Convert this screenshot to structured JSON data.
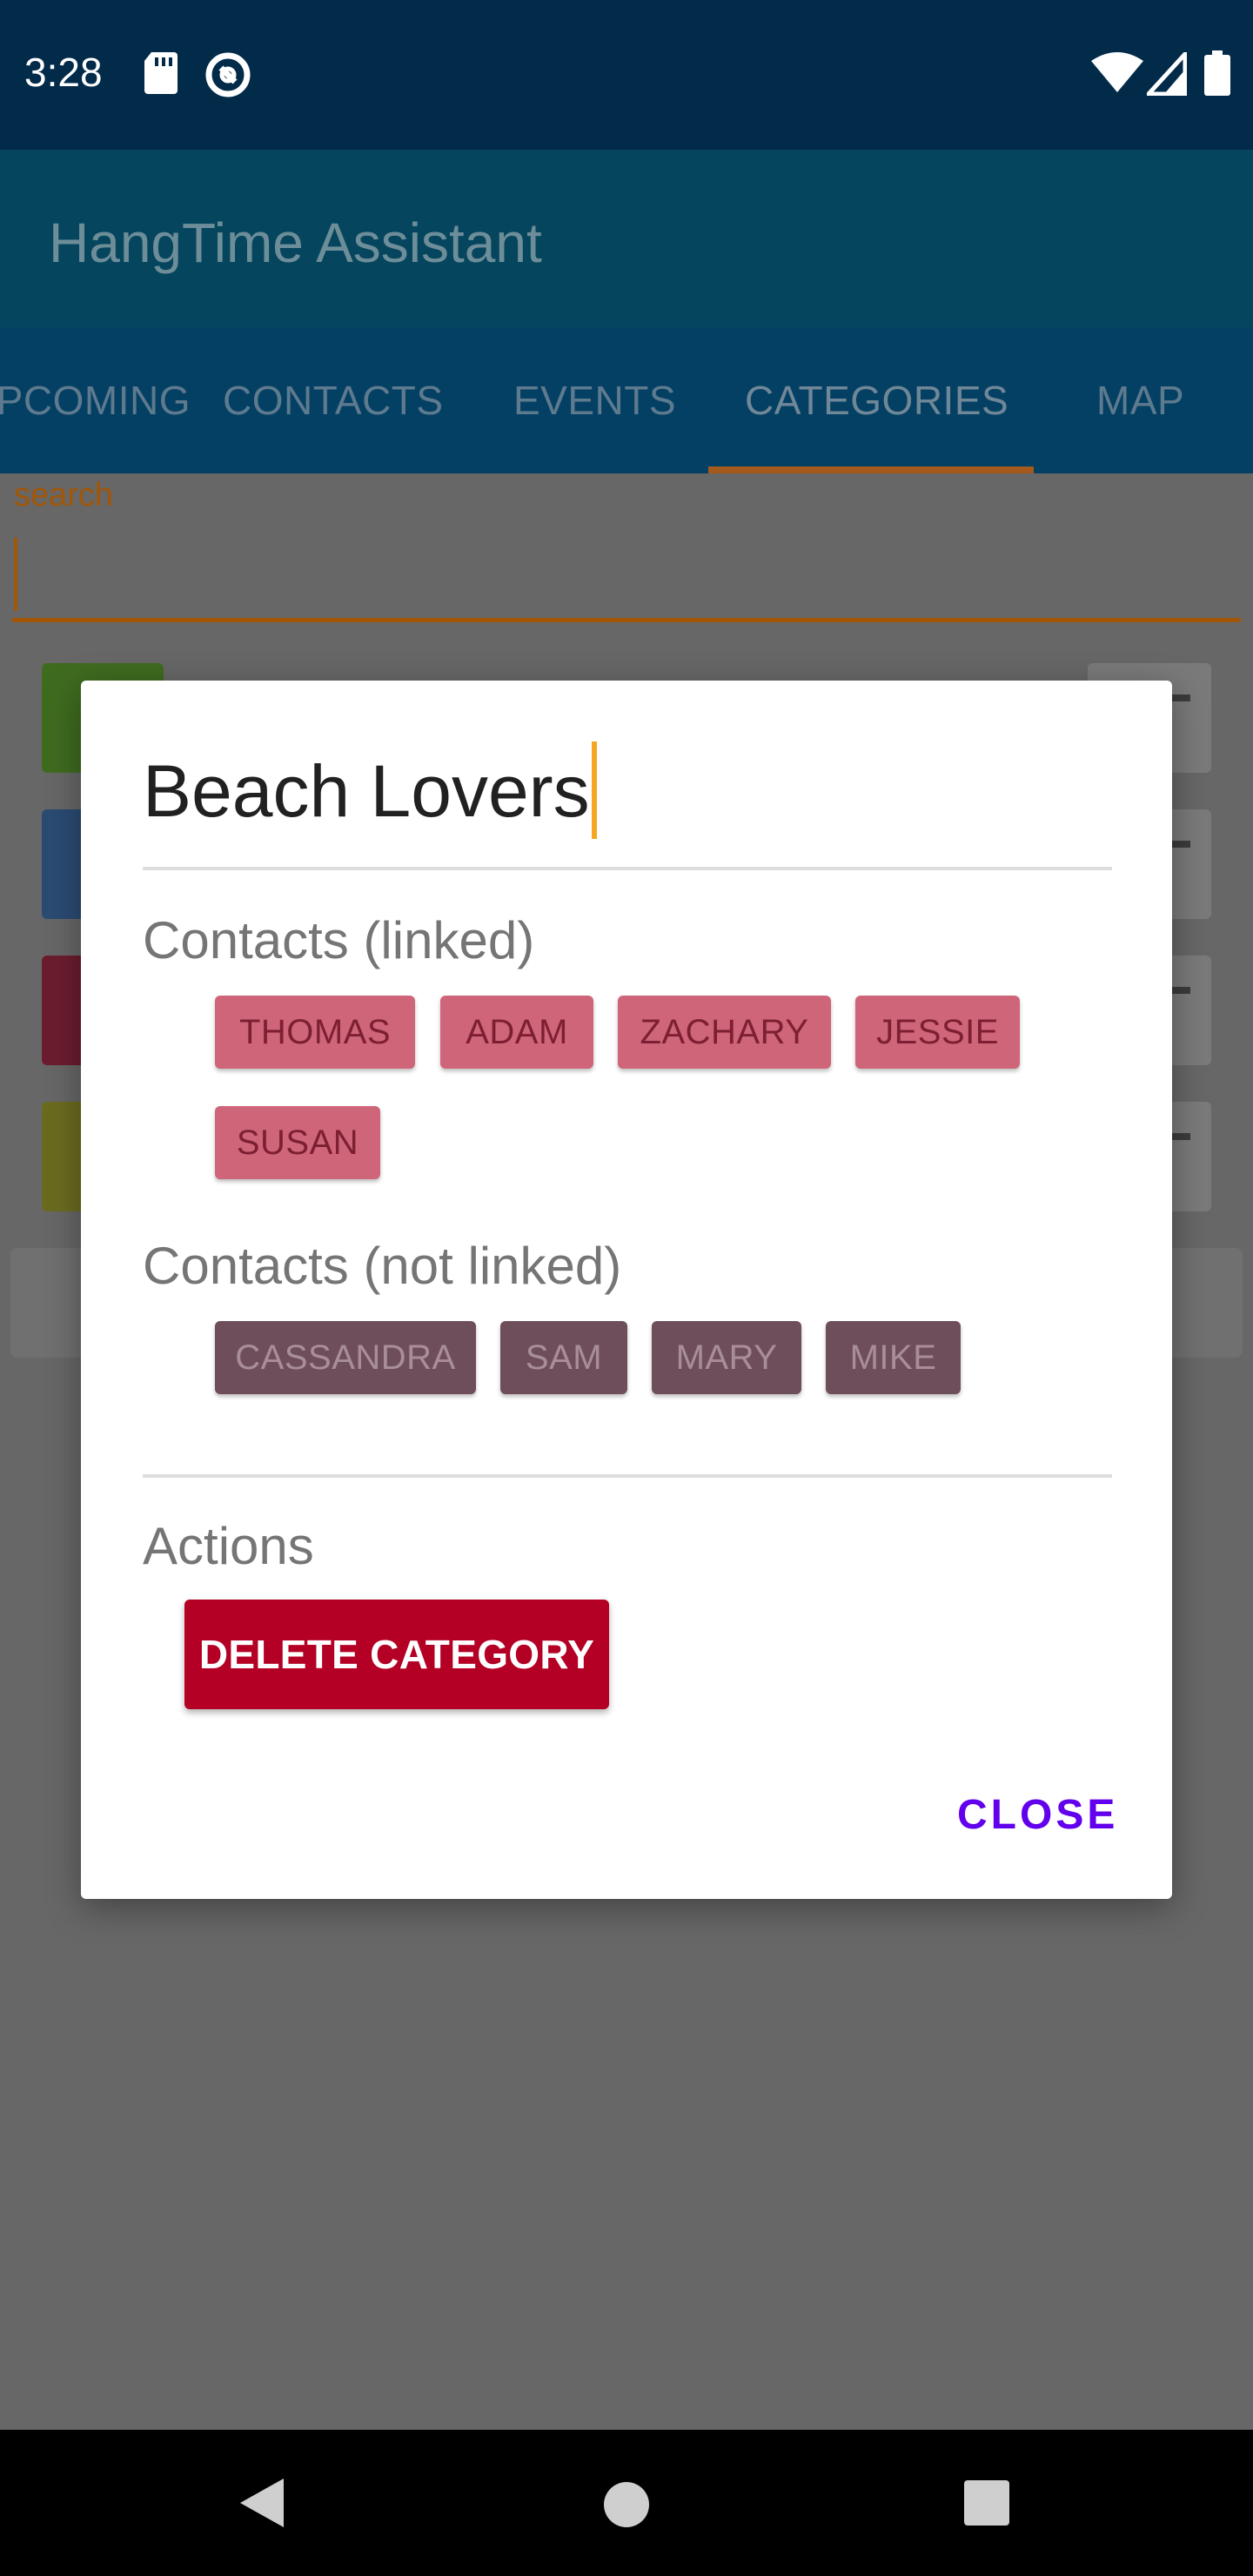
{
  "status_bar": {
    "time": "3:28",
    "icons": [
      "sd-card-icon",
      "nfc-icon",
      "wifi-icon",
      "signal-icon",
      "battery-icon"
    ]
  },
  "app_bar": {
    "title": "HangTime Assistant"
  },
  "tabs": [
    {
      "label": "UPCOMING"
    },
    {
      "label": "CONTACTS"
    },
    {
      "label": "EVENTS"
    },
    {
      "label": "CATEGORIES",
      "selected": true
    },
    {
      "label": "MAP"
    }
  ],
  "search": {
    "label": "search",
    "value": ""
  },
  "category_swatch_colors": [
    "#3F6B1F",
    "#2B4B73",
    "#6B1D2F",
    "#6B6B1F"
  ],
  "dialog": {
    "category_name": "Beach Lovers",
    "linked_heading": "Contacts (linked)",
    "linked_contacts": [
      "THOMAS",
      "ADAM",
      "ZACHARY",
      "JESSIE",
      "SUSAN"
    ],
    "unlinked_heading": "Contacts (not linked)",
    "unlinked_contacts": [
      "CASSANDRA",
      "SAM",
      "MARY",
      "MIKE"
    ],
    "actions_heading": "Actions",
    "delete_label": "DELETE CATEGORY",
    "close_label": "CLOSE"
  },
  "colors": {
    "status_bar": "#022A49",
    "linked_chip": "#CF6579",
    "unlinked_chip": "#6E4E5A",
    "delete_button": "#B30024",
    "close_text": "#6200EE",
    "accent": "#F5A623"
  },
  "nav_bar": {
    "icons": [
      "back-icon",
      "home-icon",
      "recents-icon"
    ]
  }
}
